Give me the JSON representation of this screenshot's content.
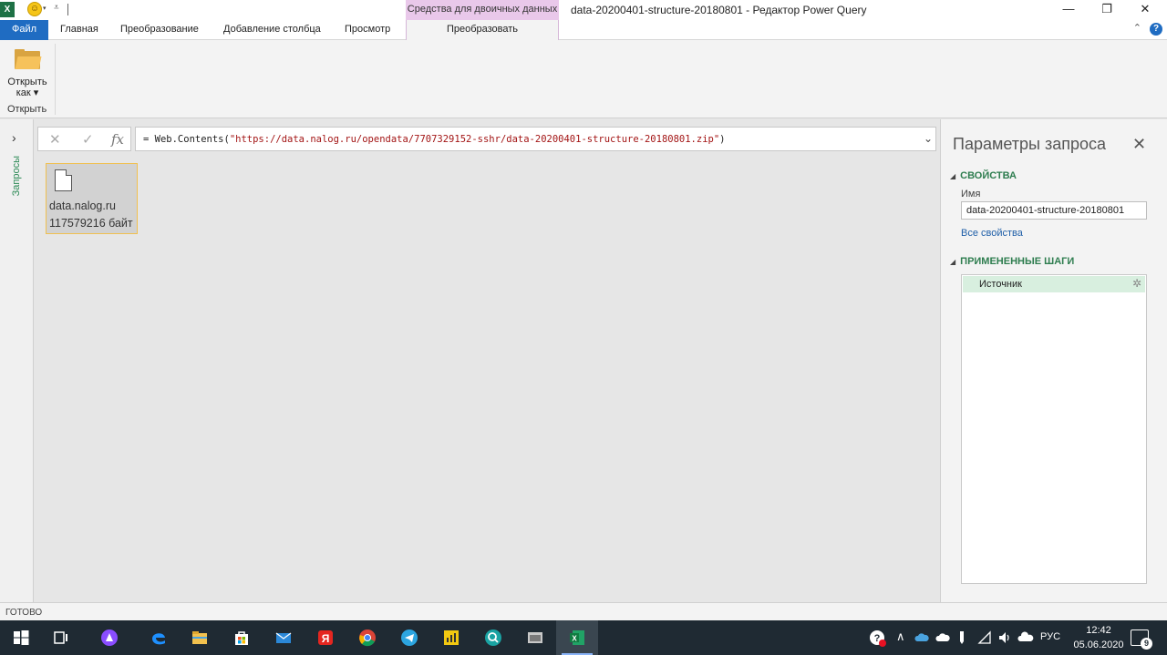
{
  "window": {
    "title": "data-20200401-structure-20180801 - Редактор Power Query",
    "context_group": "Средства для двоичных данных",
    "minimize": "—",
    "restore": "❐",
    "close": "✕"
  },
  "qat": {
    "excel": "X",
    "smile": "☺",
    "caret": "▾",
    "more": "⩡"
  },
  "tabs": {
    "file": "Файл",
    "home": "Главная",
    "transform": "Преобразование",
    "add_column": "Добавление столбца",
    "view": "Просмотр",
    "context_transform": "Преобразовать"
  },
  "ribbon": {
    "open_as": "Открыть как",
    "open_as_caret": "▾",
    "group_open": "Открыть",
    "collapse": "⌃",
    "help": "?"
  },
  "nav": {
    "expand": "›",
    "queries": "Запросы"
  },
  "formula": {
    "cancel": "✕",
    "confirm": "✓",
    "fx": "fx",
    "prefix": "= Web.Contents(",
    "string": "\"https://data.nalog.ru/opendata/7707329152-sshr/data-20200401-structure-20180801.zip\"",
    "suffix": ")",
    "dropdown": "⌄"
  },
  "binary": {
    "name": "data.nalog.ru",
    "size": "117579216 байт"
  },
  "query_settings": {
    "title": "Параметры запроса",
    "close": "✕",
    "properties_header": "СВОЙСТВА",
    "name_label": "Имя",
    "name_value": "data-20200401-structure-20180801",
    "all_properties": "Все свойства",
    "steps_header": "ПРИМЕНЕННЫЕ ШАГИ",
    "steps": [
      {
        "label": "Источник",
        "gear": "✲"
      }
    ]
  },
  "status": {
    "text": "ГОТОВО"
  },
  "taskbar": {
    "tray_caret": "∧",
    "language": "РУС",
    "time": "12:42",
    "date": "05.06.2020",
    "notifications": "9"
  },
  "colors": {
    "file_tab": "#1f6cc2",
    "context_tab": "#e9c8ea",
    "accent_green": "#2e7d4f",
    "step_selected": "#d8efdf",
    "taskbar": "#1f2a33",
    "formula_string": "#a31515"
  }
}
